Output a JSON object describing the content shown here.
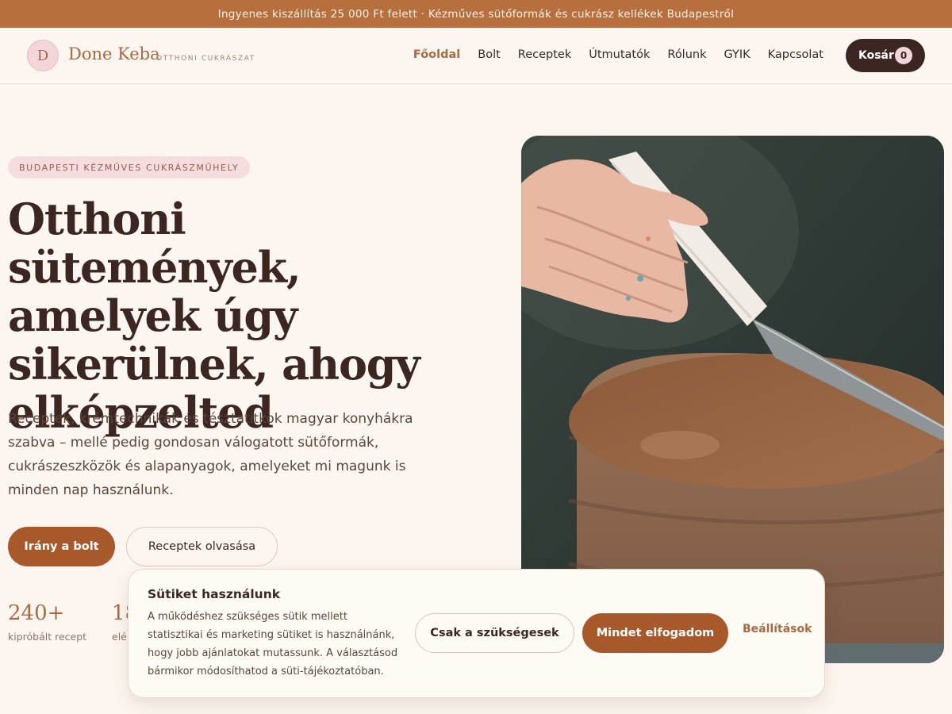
{
  "announcement": "Ingyenes kiszállítás 25 000 Ft felett · Kézműves sütőformák és cukrász kellékek Budapestről",
  "brand": {
    "initial": "D",
    "name": "Done Keba",
    "tagline": "OTTHONI CUKRÁSZAT"
  },
  "nav": {
    "items": [
      {
        "label": "Főoldal"
      },
      {
        "label": "Bolt"
      },
      {
        "label": "Receptek"
      },
      {
        "label": "Útmutatók"
      },
      {
        "label": "Rólunk"
      },
      {
        "label": "GYIK"
      },
      {
        "label": "Kapcsolat"
      }
    ],
    "active_index": 0
  },
  "cart": {
    "label": "Kosár",
    "count": "0"
  },
  "hero": {
    "badge": "BUDAPESTI KÉZMŰVES CUKRÁSZMŰHELY",
    "title": "Otthoni sütemények, amelyek úgy sikerülnek, ahogy elképzelted",
    "text": "Receptek, krémtechnikák és tésztatitkok magyar konyhákra szabva – mellé pedig gondosan válogatott sütőformák, cukrászeszközök és alapanyagok, amelyeket mi magunk is minden nap használunk.",
    "primary_button": "Irány a bolt",
    "secondary_button": "Receptek olvasása",
    "image_alt_icon": "cake-frosting-photo-icon"
  },
  "stats": [
    {
      "value": "240+",
      "label": "kipróbált recept"
    },
    {
      "value": "18",
      "label": "elé"
    }
  ],
  "cookie": {
    "title": "Sütiket használunk",
    "text": "A működéshez szükséges sütik mellett statisztikai és marketing sütiket is használnánk, hogy jobb ajánlatokat mutassunk. A választásod bármikor módosíthatod a süti-tájékoztatóban.",
    "necessary_button": "Csak a szükségesek",
    "accept_button": "Mindet elfogadom",
    "settings_link": "Beállítások"
  },
  "colors": {
    "accent": "#a8592c",
    "topbar": "#b7703d",
    "dark": "#3b2621",
    "background": "#fdf6f0"
  }
}
